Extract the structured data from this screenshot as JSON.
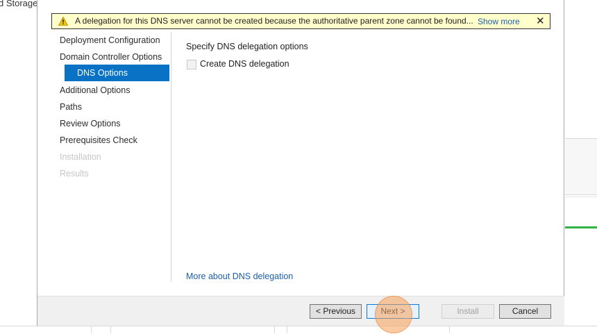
{
  "background": {
    "title_fragment": "d Storage"
  },
  "warning": {
    "icon": "warning-icon",
    "message": "A delegation for this DNS server cannot be created because the authoritative parent zone cannot be found...",
    "show_more": "Show more",
    "close": "✕"
  },
  "nav": {
    "items": [
      {
        "label": "Deployment Configuration",
        "state": "normal"
      },
      {
        "label": "Domain Controller Options",
        "state": "normal"
      },
      {
        "label": "DNS Options",
        "state": "active"
      },
      {
        "label": "Additional Options",
        "state": "normal"
      },
      {
        "label": "Paths",
        "state": "normal"
      },
      {
        "label": "Review Options",
        "state": "normal"
      },
      {
        "label": "Prerequisites Check",
        "state": "normal"
      },
      {
        "label": "Installation",
        "state": "disabled"
      },
      {
        "label": "Results",
        "state": "disabled"
      }
    ]
  },
  "content": {
    "heading": "Specify DNS delegation options",
    "checkbox_label": "Create DNS delegation",
    "checkbox_checked": false,
    "link": "More about DNS delegation"
  },
  "buttons": {
    "previous": "< Previous",
    "next": "Next >",
    "install": "Install",
    "cancel": "Cancel"
  },
  "colors": {
    "accent": "#0972c5",
    "warning_bg": "#ffffcc",
    "link": "#1e5ea8",
    "status_green": "#31b044"
  }
}
